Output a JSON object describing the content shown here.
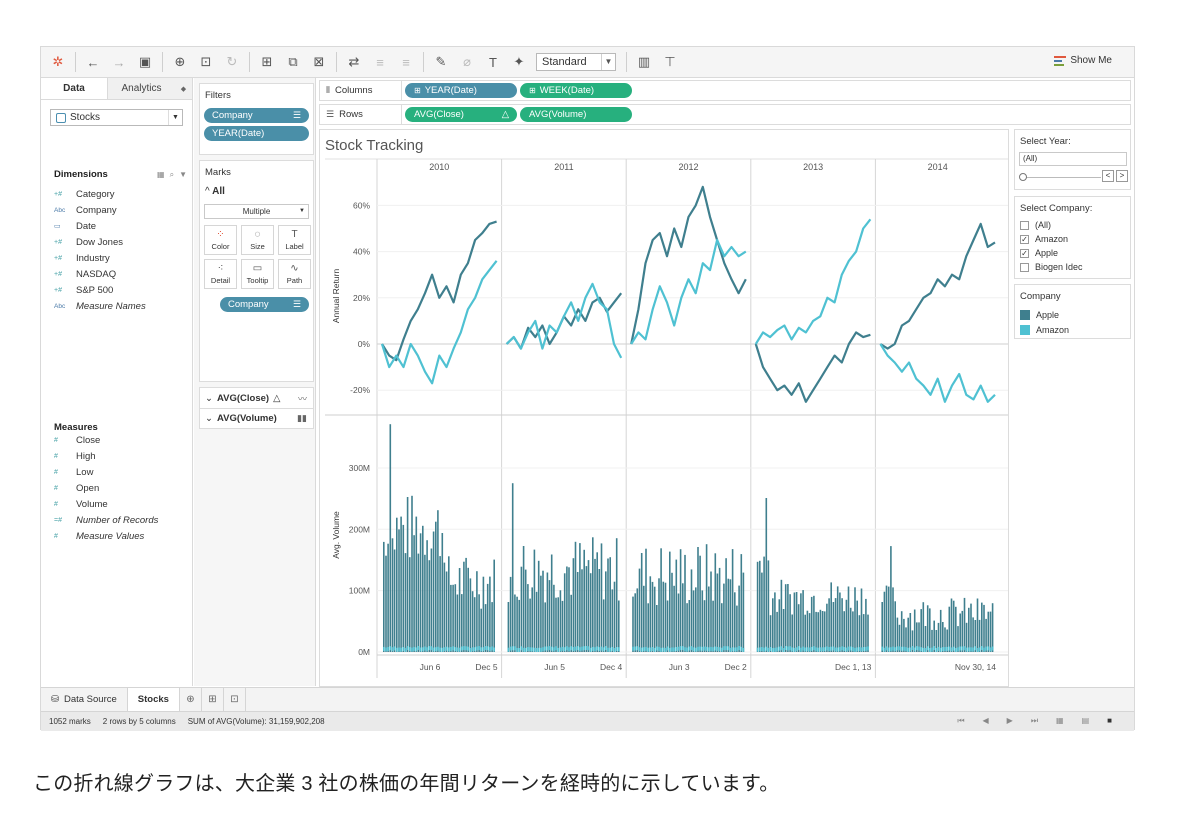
{
  "toolbar": {
    "format_select": "Standard",
    "show_me": "Show Me",
    "icons": [
      "tableau-logo-icon",
      "undo-icon",
      "redo-icon",
      "save-icon",
      "new-datasource-icon",
      "pause-updates-icon",
      "refresh-icon",
      "new-worksheet-icon",
      "duplicate-icon",
      "clear-icon",
      "swap-icon",
      "sort-asc-icon",
      "sort-desc-icon",
      "highlight-icon",
      "group-icon",
      "label-icon",
      "pin-icon",
      "fit-icon",
      "presentation-icon"
    ]
  },
  "datapane": {
    "tab_data": "Data",
    "tab_analytics": "Analytics",
    "datasource": "Stocks",
    "dimensions_title": "Dimensions",
    "dimensions": [
      {
        "icon": "+#",
        "label": "Category"
      },
      {
        "icon": "Abc",
        "label": "Company"
      },
      {
        "icon": "cal",
        "label": "Date"
      },
      {
        "icon": "+#",
        "label": "Dow Jones"
      },
      {
        "icon": "+#",
        "label": "Industry"
      },
      {
        "icon": "+#",
        "label": "NASDAQ"
      },
      {
        "icon": "+#",
        "label": "S&P 500"
      },
      {
        "icon": "Abc",
        "label": "Measure Names"
      }
    ],
    "measures_title": "Measures",
    "measures": [
      {
        "icon": "#",
        "label": "Close"
      },
      {
        "icon": "#",
        "label": "High"
      },
      {
        "icon": "#",
        "label": "Low"
      },
      {
        "icon": "#",
        "label": "Open"
      },
      {
        "icon": "#",
        "label": "Volume"
      },
      {
        "icon": "=#",
        "label": "Number of Records"
      },
      {
        "icon": "#",
        "label": "Measure Values"
      }
    ]
  },
  "filters": {
    "title": "Filters",
    "items": [
      "Company",
      "YEAR(Date)"
    ]
  },
  "marks": {
    "title": "Marks",
    "all_label": "All",
    "mark_type": "Multiple",
    "buttons": [
      "Color",
      "Size",
      "Label",
      "Detail",
      "Tooltip",
      "Path"
    ],
    "color_pill": "Company",
    "measure1": "AVG(Close)",
    "measure2": "AVG(Volume)"
  },
  "shelves": {
    "columns_label": "Columns",
    "rows_label": "Rows",
    "col_pill1": "YEAR(Date)",
    "col_pill2": "WEEK(Date)",
    "row_pill1": "AVG(Close)",
    "row_pill2": "AVG(Volume)"
  },
  "view": {
    "title": "Stock Tracking",
    "years": [
      "2010",
      "2011",
      "2012",
      "2013",
      "2014"
    ],
    "return_axis_label": "Annual Return",
    "return_ticks": [
      "60%",
      "40%",
      "20%",
      "0%",
      "-20%"
    ],
    "volume_axis_label": "Avg. Volume",
    "volume_ticks": [
      "300M",
      "200M",
      "100M",
      "0M"
    ],
    "x_ticks": [
      [
        "Jun 6",
        "Dec 5"
      ],
      [
        "Jun 5",
        "Dec 4"
      ],
      [
        "Jun 3",
        "Dec 2"
      ],
      [
        "",
        "Dec 1, 13"
      ],
      [
        "",
        "Nov 30, 14"
      ]
    ]
  },
  "chart_data": {
    "type": "line",
    "title": "Stock Tracking",
    "panels": [
      "2010",
      "2011",
      "2012",
      "2013",
      "2014"
    ],
    "ylabel_top": "Annual Return",
    "ylim_top": [
      -0.25,
      0.65
    ],
    "ylabel_bottom": "Avg. Volume",
    "ylim_bottom": [
      0,
      380000000
    ],
    "series": [
      {
        "name": "Apple",
        "color": "#3f7f8e",
        "returns": [
          [
            0.0,
            -0.05,
            -0.07,
            0.02,
            0.1,
            0.15,
            0.22,
            0.3,
            0.2,
            0.25,
            0.18,
            0.3,
            0.35,
            0.45,
            0.48,
            0.52,
            0.53
          ],
          [
            0.0,
            0.03,
            -0.02,
            0.07,
            0.03,
            0.08,
            0.0,
            0.05,
            0.12,
            0.08,
            0.15,
            0.1,
            0.18,
            0.2,
            0.14,
            0.18,
            0.22
          ],
          [
            0.0,
            0.15,
            0.35,
            0.45,
            0.48,
            0.38,
            0.5,
            0.42,
            0.55,
            0.6,
            0.68,
            0.55,
            0.45,
            0.35,
            0.28,
            0.22,
            0.28
          ],
          [
            0.0,
            -0.1,
            -0.15,
            -0.2,
            -0.18,
            -0.22,
            -0.17,
            -0.25,
            -0.2,
            -0.15,
            -0.1,
            -0.05,
            -0.08,
            0.0,
            0.05,
            0.03,
            0.04
          ],
          [
            0.0,
            -0.02,
            0.0,
            0.08,
            0.1,
            0.15,
            0.2,
            0.22,
            0.28,
            0.25,
            0.3,
            0.28,
            0.38,
            0.45,
            0.52,
            0.42,
            0.44
          ]
        ]
      },
      {
        "name": "Amazon",
        "color": "#4fc1d2",
        "returns": [
          [
            0.0,
            -0.1,
            -0.05,
            -0.1,
            0.0,
            -0.05,
            -0.12,
            -0.17,
            -0.05,
            -0.1,
            -0.02,
            0.05,
            0.15,
            0.2,
            0.28,
            0.32,
            0.36
          ],
          [
            0.0,
            0.03,
            -0.02,
            0.05,
            0.1,
            -0.02,
            0.08,
            0.05,
            0.12,
            0.18,
            0.1,
            0.2,
            0.26,
            0.18,
            0.15,
            0.0,
            -0.06
          ],
          [
            0.0,
            0.05,
            0.02,
            0.15,
            0.25,
            0.18,
            0.08,
            0.2,
            0.28,
            0.22,
            0.35,
            0.32,
            0.45,
            0.38,
            0.42,
            0.38,
            0.4
          ],
          [
            0.0,
            0.05,
            0.03,
            0.06,
            0.08,
            0.02,
            0.07,
            0.05,
            0.1,
            0.12,
            0.2,
            0.18,
            0.3,
            0.36,
            0.4,
            0.5,
            0.54
          ],
          [
            0.0,
            -0.05,
            -0.08,
            -0.12,
            -0.08,
            -0.15,
            -0.18,
            -0.22,
            -0.15,
            -0.25,
            -0.18,
            -0.13,
            -0.22,
            -0.24,
            -0.18,
            -0.25,
            -0.22
          ]
        ]
      }
    ]
  },
  "right_panel": {
    "select_year_title": "Select Year:",
    "select_year_value": "(All)",
    "select_company_title": "Select Company:",
    "companies": [
      {
        "label": "(All)",
        "checked": false
      },
      {
        "label": "Amazon",
        "checked": true
      },
      {
        "label": "Apple",
        "checked": true
      },
      {
        "label": "Biogen Idec",
        "checked": false
      }
    ],
    "legend_title": "Company",
    "legend": [
      {
        "label": "Apple",
        "color": "#3f7f8e"
      },
      {
        "label": "Amazon",
        "color": "#4fc1d2"
      }
    ]
  },
  "sheet_tabs": {
    "datasource": "Data Source",
    "active": "Stocks"
  },
  "status": {
    "marks": "1052 marks",
    "dims": "2 rows by 5 columns",
    "sum": "SUM of AVG(Volume): 31,159,902,208"
  },
  "caption": "この折れ線グラフは、大企業 3 社の株価の年間リターンを経時的に示しています。"
}
